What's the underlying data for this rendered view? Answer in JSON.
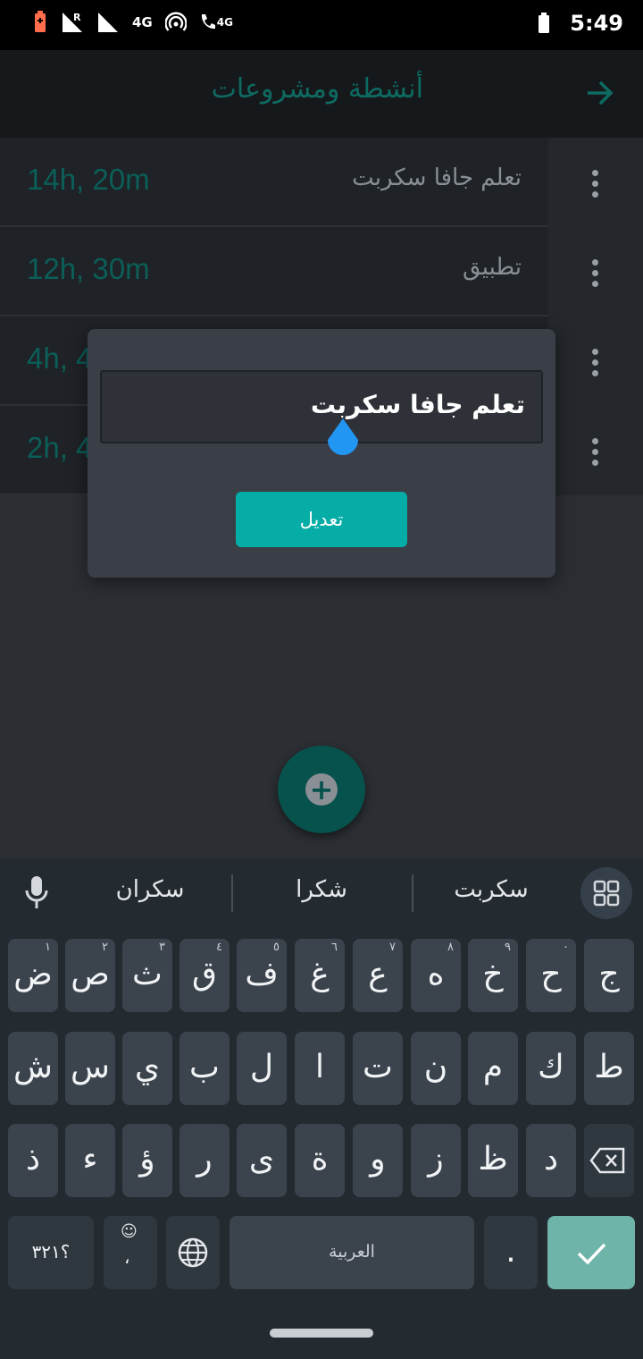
{
  "status": {
    "time": "5:49",
    "network_label": "4G",
    "call_label": "4G",
    "roaming": "R"
  },
  "appbar": {
    "title": "أنشطة ومشروعات",
    "back_icon": "arrow-right-icon"
  },
  "activities": [
    {
      "name": "تعلم جافا سكربت",
      "time": "14h, 20m"
    },
    {
      "name": "تطبيق",
      "time": "12h, 30m"
    },
    {
      "name": "",
      "time": "4h, 4"
    },
    {
      "name": "",
      "time": "2h, 4"
    }
  ],
  "dialog": {
    "input_value": "تعلم جافا سكربت",
    "button_label": "تعديل"
  },
  "fab": {
    "icon": "add-icon"
  },
  "keyboard": {
    "suggestions": [
      "سكران",
      "شكرا",
      "سكربت"
    ],
    "row1": [
      {
        "char": "ض",
        "num": "١"
      },
      {
        "char": "ص",
        "num": "٢"
      },
      {
        "char": "ث",
        "num": "٣"
      },
      {
        "char": "ق",
        "num": "٤"
      },
      {
        "char": "ف",
        "num": "٥"
      },
      {
        "char": "غ",
        "num": "٦"
      },
      {
        "char": "ع",
        "num": "٧"
      },
      {
        "char": "ه",
        "num": "٨"
      },
      {
        "char": "خ",
        "num": "٩"
      },
      {
        "char": "ح",
        "num": "٠"
      },
      {
        "char": "ج",
        "num": ""
      }
    ],
    "row2": [
      "ش",
      "س",
      "ي",
      "ب",
      "ل",
      "ا",
      "ت",
      "ن",
      "م",
      "ك",
      "ط"
    ],
    "row3": [
      "ذ",
      "ء",
      "ؤ",
      "ر",
      "ى",
      "ة",
      "و",
      "ز",
      "ظ",
      "د"
    ],
    "symbols_label": "؟٣٢١",
    "comma_label": "،",
    "space_label": "العربية",
    "period_label": "."
  },
  "colors": {
    "accent": "#06aca6",
    "appbar_bg": "#16191c",
    "keyboard_bg": "#232a30"
  }
}
